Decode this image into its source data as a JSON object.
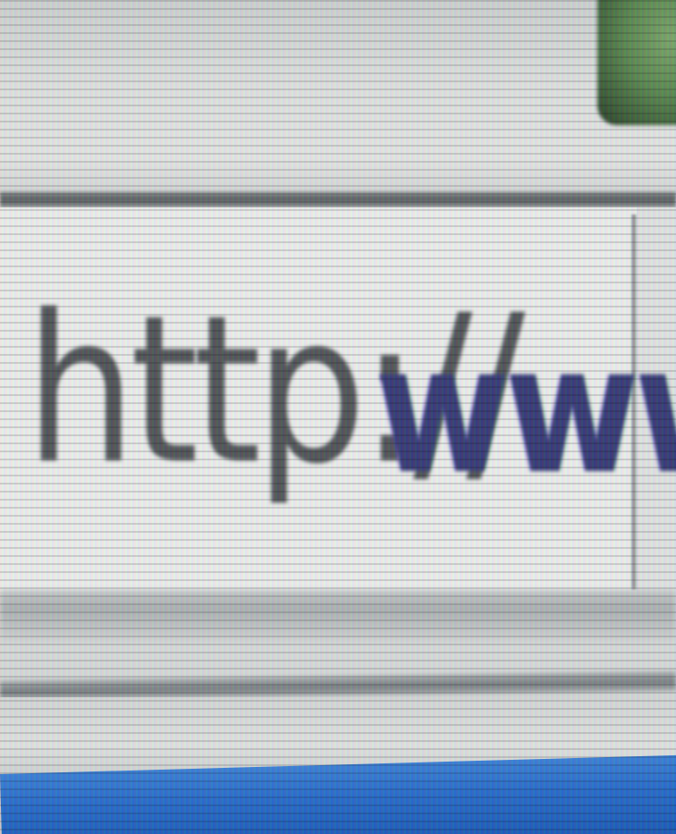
{
  "address_bar": {
    "scheme": "http://",
    "host_fragment": "www."
  },
  "colors": {
    "toolbar_background": "#e1e4e3",
    "field_background": "#eef0ef",
    "scheme_text": "#55595d",
    "host_text": "#3b3f7a",
    "status_bar": "#2c6fcc",
    "toolbar_icon": "#5e8a55"
  },
  "icons": {
    "toolbar_icon": "green-toolbar-icon"
  }
}
